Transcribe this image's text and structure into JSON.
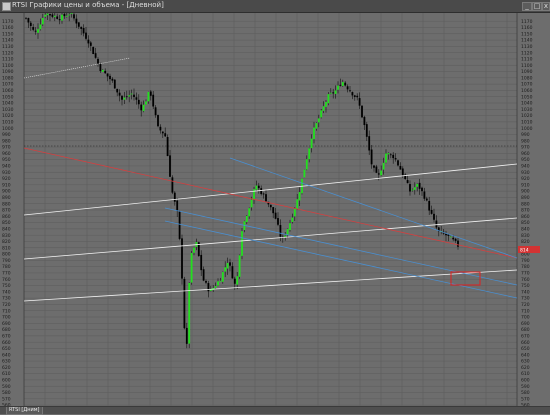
{
  "window": {
    "title": "RTSI Графики цены и объема - [Дневной]",
    "controls": {
      "minimize": "_",
      "maximize": "□",
      "close": "x"
    }
  },
  "chart": {
    "type": "candlestick",
    "y_ticks": [
      1170,
      1160,
      1150,
      1140,
      1130,
      1120,
      1110,
      1100,
      1090,
      1080,
      1070,
      1060,
      1050,
      1040,
      1030,
      1020,
      1010,
      1000,
      990,
      980,
      970,
      960,
      950,
      940,
      930,
      920,
      910,
      900,
      890,
      880,
      870,
      860,
      850,
      840,
      830,
      820,
      810,
      800,
      790,
      780,
      770,
      760,
      750,
      740,
      730,
      720,
      710,
      700,
      690,
      680,
      670,
      660,
      650,
      640,
      630,
      620,
      610,
      600,
      590,
      580,
      570,
      560
    ],
    "ylim": [
      557,
      1183
    ],
    "current_price": "814",
    "bull_color": "#22e01e",
    "bear_color": "#000000",
    "grid": true
  },
  "statusbar": {
    "tab_label": "RTSI [Дним]"
  },
  "colors": {
    "background": "#6d6d6d",
    "grid": "#5a5a5a",
    "channel_white": "#f2f2f2",
    "channel_blue": "#4a8fd0",
    "trend_red": "#d24040",
    "target_box": "#e02020",
    "price_marker": "#d33333"
  }
}
